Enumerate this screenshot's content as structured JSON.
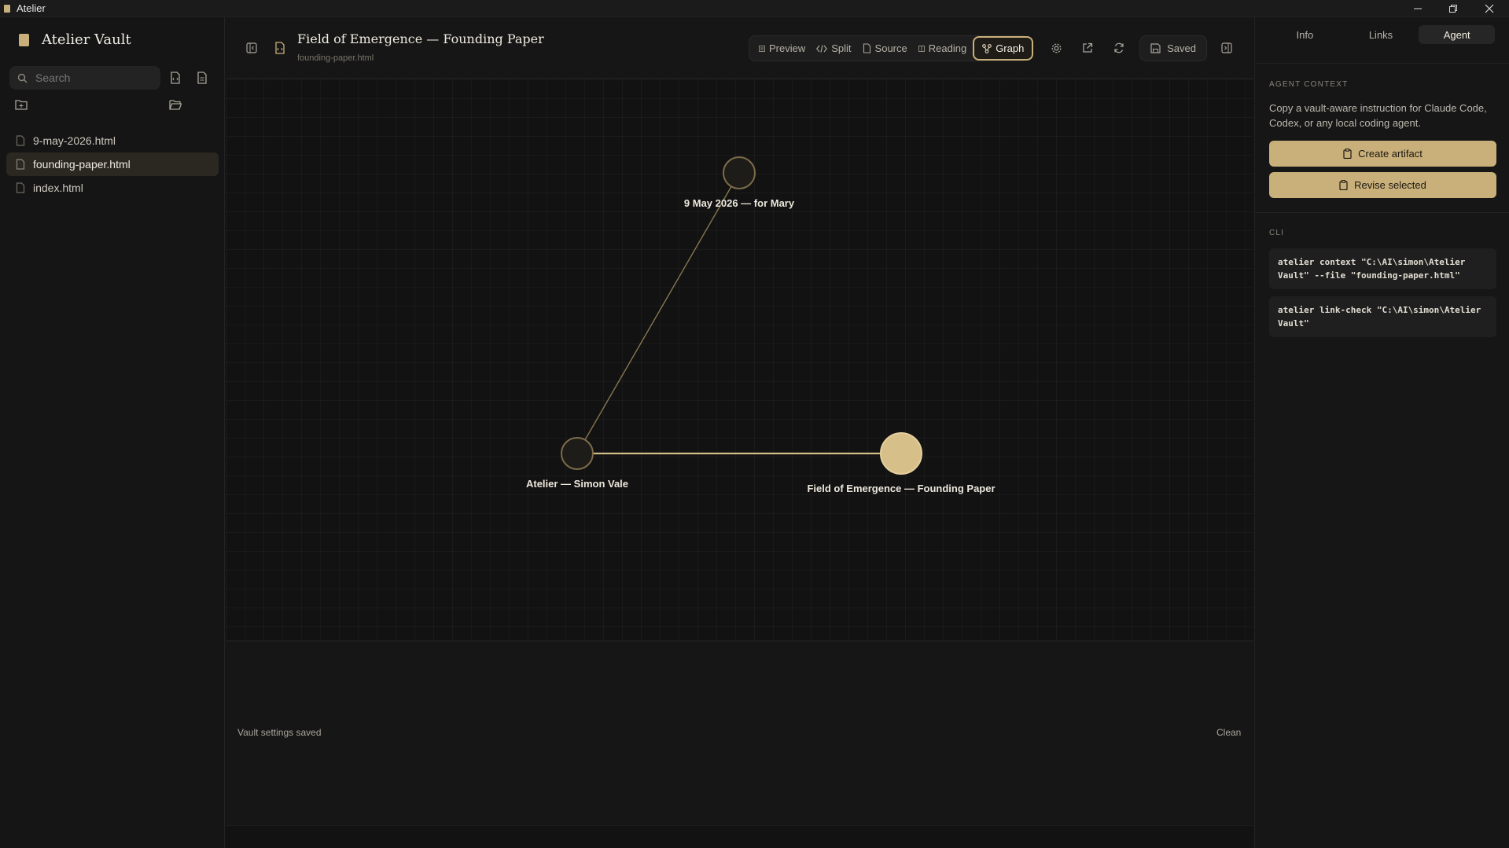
{
  "window": {
    "app_name": "Atelier"
  },
  "sidebar": {
    "vault_title": "Atelier Vault",
    "search_placeholder": "Search",
    "files": [
      {
        "name": "9-may-2026.html",
        "active": false
      },
      {
        "name": "founding-paper.html",
        "active": true
      },
      {
        "name": "index.html",
        "active": false
      }
    ]
  },
  "header": {
    "doc_title": "Field of Emergence — Founding Paper",
    "doc_filename": "founding-paper.html",
    "views": [
      {
        "label": "Preview",
        "icon": "preview-icon",
        "active": false
      },
      {
        "label": "Split",
        "icon": "code-icon",
        "active": false
      },
      {
        "label": "Source",
        "icon": "file-code-icon",
        "active": false
      },
      {
        "label": "Reading",
        "icon": "reading-icon",
        "active": false
      },
      {
        "label": "Graph",
        "icon": "graph-icon",
        "active": true
      }
    ],
    "saved_label": "Saved"
  },
  "graph": {
    "nodes": [
      {
        "id": "mary",
        "label": "9 May 2026 — for Mary",
        "current": false
      },
      {
        "id": "atelier",
        "label": "Atelier — Simon Vale",
        "current": false
      },
      {
        "id": "founding",
        "label": "Field of Emergence — Founding Paper",
        "current": true
      }
    ],
    "edges": [
      {
        "from": "mary",
        "to": "atelier"
      },
      {
        "from": "atelier",
        "to": "founding"
      }
    ]
  },
  "status": {
    "message": "Vault settings saved",
    "state": "Clean"
  },
  "right_panel": {
    "tabs": [
      {
        "label": "Info",
        "active": false
      },
      {
        "label": "Links",
        "active": false
      },
      {
        "label": "Agent",
        "active": true
      }
    ],
    "agent_context_label": "AGENT CONTEXT",
    "agent_context_desc": "Copy a vault-aware instruction for Claude Code, Codex, or any local coding agent.",
    "create_artifact_label": "Create artifact",
    "revise_selected_label": "Revise selected",
    "cli_label": "CLI",
    "cli_commands": [
      "atelier context \"C:\\AI\\simon\\Atelier Vault\" --file \"founding-paper.html\"",
      "atelier link-check \"C:\\AI\\simon\\Atelier Vault\""
    ]
  },
  "colors": {
    "accent": "#c9b07a",
    "background": "#141414"
  }
}
